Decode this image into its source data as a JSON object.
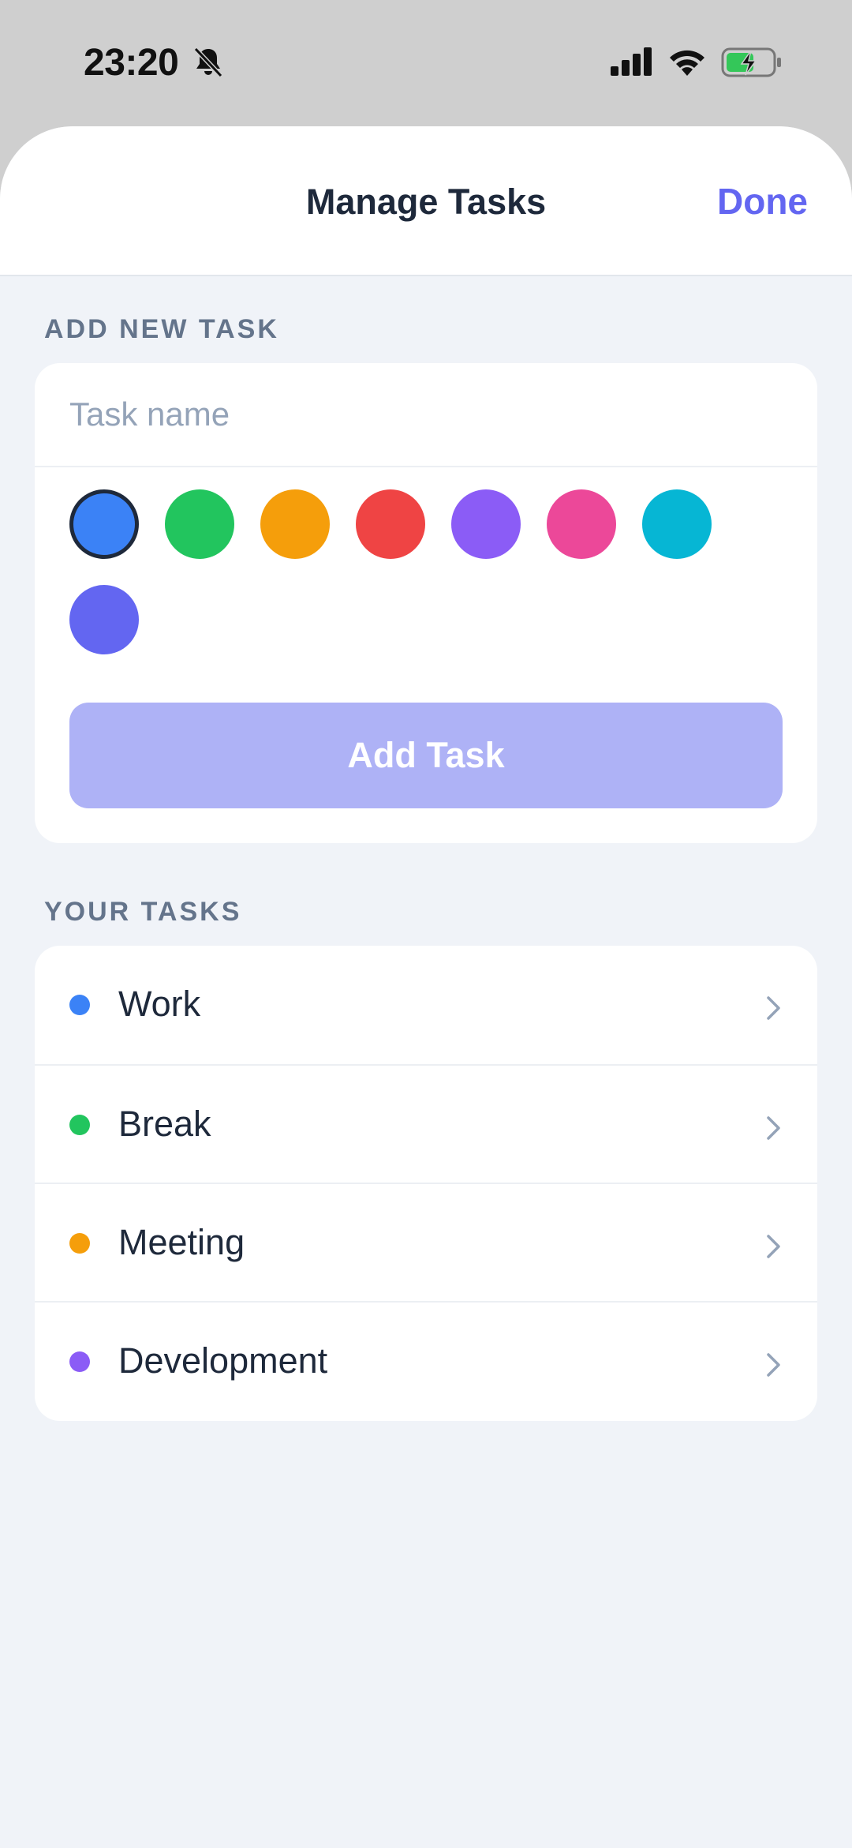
{
  "status_bar": {
    "time": "23:20",
    "icons": [
      "bell-slash-icon",
      "cellular-signal-icon",
      "wifi-icon",
      "battery-charging-icon"
    ]
  },
  "header": {
    "title": "Manage Tasks",
    "done_label": "Done"
  },
  "add_section": {
    "label": "ADD NEW TASK",
    "input_placeholder": "Task name",
    "input_value": "",
    "colors": [
      {
        "name": "blue",
        "hex": "#3b82f6",
        "selected": true
      },
      {
        "name": "green",
        "hex": "#22c55e",
        "selected": false
      },
      {
        "name": "amber",
        "hex": "#f59e0b",
        "selected": false
      },
      {
        "name": "red",
        "hex": "#ef4444",
        "selected": false
      },
      {
        "name": "violet",
        "hex": "#8b5cf6",
        "selected": false
      },
      {
        "name": "pink",
        "hex": "#ec4899",
        "selected": false
      },
      {
        "name": "cyan",
        "hex": "#06b6d4",
        "selected": false
      },
      {
        "name": "indigo",
        "hex": "#6366f1",
        "selected": false
      }
    ],
    "add_button_label": "Add Task"
  },
  "tasks_section": {
    "label": "YOUR TASKS",
    "tasks": [
      {
        "name": "Work",
        "color": "#3b82f6"
      },
      {
        "name": "Break",
        "color": "#22c55e"
      },
      {
        "name": "Meeting",
        "color": "#f59e0b"
      },
      {
        "name": "Development",
        "color": "#8b5cf6"
      }
    ]
  },
  "accent_color": "#6366f1"
}
